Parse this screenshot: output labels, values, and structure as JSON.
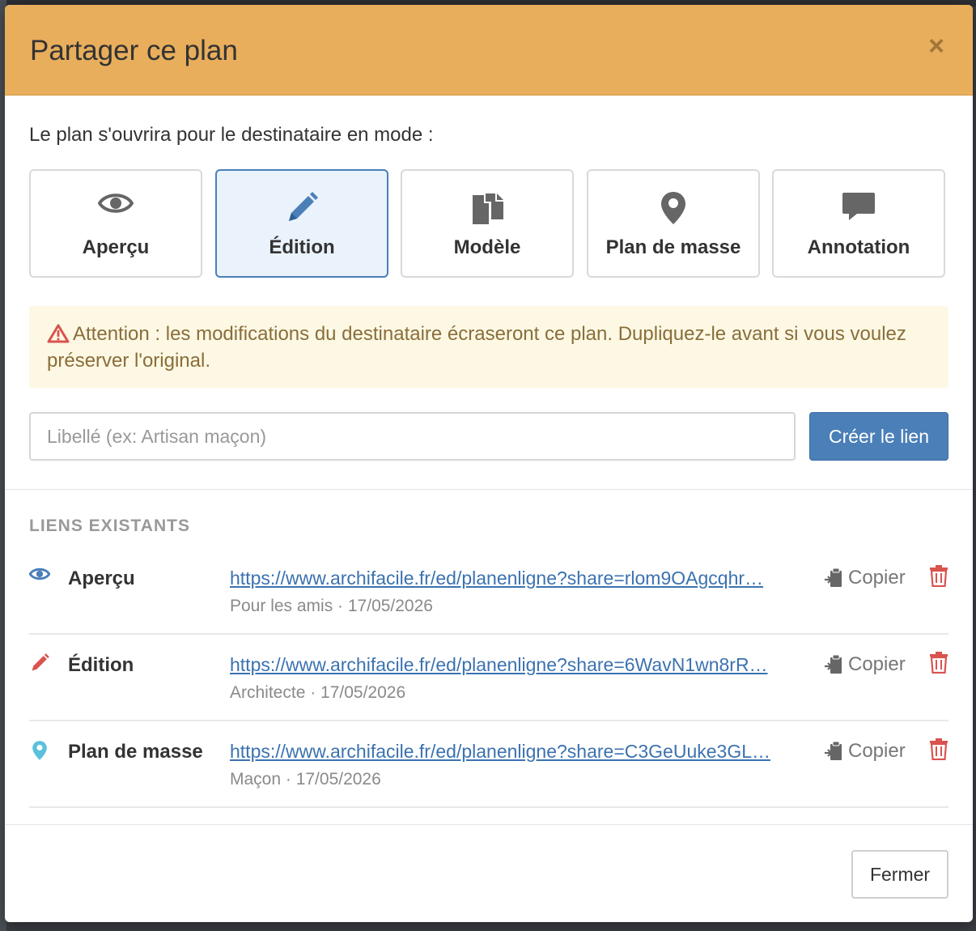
{
  "modal": {
    "title": "Partager ce plan",
    "close_symbol": "×"
  },
  "intro_text": "Le plan s'ouvrira pour le destinataire en mode :",
  "modes": [
    {
      "label": "Aperçu",
      "icon": "eye-icon",
      "active": false
    },
    {
      "label": "Édition",
      "icon": "pencil-icon",
      "active": true
    },
    {
      "label": "Modèle",
      "icon": "copy-icon",
      "active": false
    },
    {
      "label": "Plan de masse",
      "icon": "map-pin-icon",
      "active": false
    },
    {
      "label": "Annotation",
      "icon": "comment-icon",
      "active": false
    }
  ],
  "warning": {
    "icon": "warning-icon",
    "text": "Attention : les modifications du destinataire écraseront ce plan. Dupliquez-le avant si vous voulez préserver l'original."
  },
  "create": {
    "placeholder": "Libellé (ex: Artisan maçon)",
    "value": "",
    "button_label": "Créer le lien"
  },
  "existing": {
    "title": "LIENS EXISTANTS",
    "copy_label": "Copier",
    "links": [
      {
        "mode": "Aperçu",
        "icon": "eye-icon",
        "url": "https://www.archifacile.fr/ed/planenligne?share=rlom9OAgcqhr…",
        "meta": "Pour les amis · 17/05/2026"
      },
      {
        "mode": "Édition",
        "icon": "pencil-icon",
        "url": "https://www.archifacile.fr/ed/planenligne?share=6WavN1wn8rR…",
        "meta": "Architecte · 17/05/2026"
      },
      {
        "mode": "Plan de masse",
        "icon": "map-pin-icon",
        "url": "https://www.archifacile.fr/ed/planenligne?share=C3GeUuke3GL…",
        "meta": "Maçon · 17/05/2026"
      }
    ]
  },
  "footer": {
    "close_label": "Fermer"
  },
  "colors": {
    "header_bg": "#e8ae5c",
    "primary": "#4a7fb8",
    "warning_bg": "#fcf8e3",
    "warning_text": "#8a6d3b",
    "danger": "#d9534f",
    "link": "#3b72b0"
  }
}
